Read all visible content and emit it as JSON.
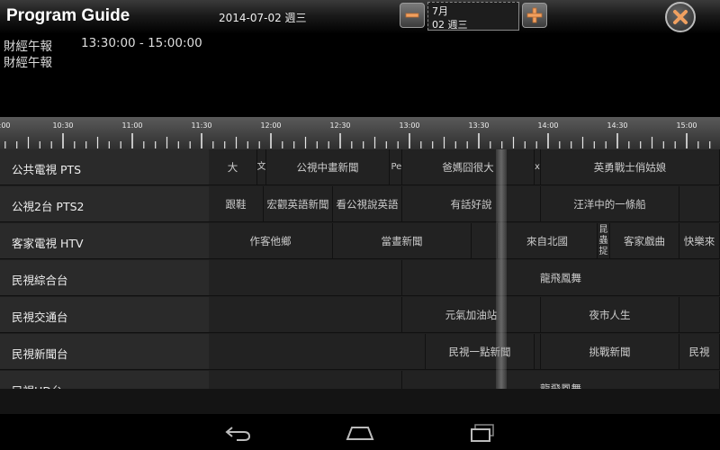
{
  "app": {
    "title": "Program Guide"
  },
  "header": {
    "date_label": "2014-07-02 週三",
    "date_picker": {
      "month": "7月",
      "day": "02  週三"
    }
  },
  "info": {
    "title_line1": "財經午報",
    "time_range": "13:30:00 - 15:00:00",
    "title_line2": "財經午報"
  },
  "timeline": {
    "labels": [
      "10:30",
      "11:00",
      "11:30",
      "12:00",
      "12:30",
      "13:00",
      "13:30",
      "14:00",
      "14:30",
      "15:00"
    ]
  },
  "channels": [
    {
      "name": "公共電視 PTS",
      "programs": [
        "大",
        "文",
        "公視中畫新聞",
        "Peo",
        "爸媽囧很大",
        "x",
        "英勇戰士俏姑娘"
      ]
    },
    {
      "name": "公視2台 PTS2",
      "programs": [
        "跟鞋",
        "宏觀英語新聞",
        "看公視說英語",
        "有話好說",
        "汪洋中的一條船",
        ""
      ]
    },
    {
      "name": "客家電視 HTV",
      "programs": [
        "作客他鄉",
        "當晝新聞",
        "",
        "來自北國",
        "昆蟲捉",
        "客家戲曲",
        "快樂來"
      ]
    },
    {
      "name": "民視綜合台",
      "programs": [
        "",
        "龍飛鳳舞"
      ]
    },
    {
      "name": "民視交通台",
      "programs": [
        "",
        "元氣加油站",
        "夜市人生",
        ""
      ]
    },
    {
      "name": "民視新聞台",
      "programs": [
        "",
        "民視一點新聞",
        "",
        "挑戰新聞",
        "民視"
      ]
    },
    {
      "name": "民視HD台",
      "programs": [
        "",
        "龍飛鳳舞"
      ]
    }
  ],
  "colors": {
    "accent_orange": "#f0a060",
    "topbar": "#1a1a1a",
    "grid_bg": "#222222"
  },
  "icons": {
    "minus": "minus-icon",
    "plus": "plus-icon",
    "close": "close-icon",
    "back": "back-icon",
    "home": "home-icon",
    "recent": "recent-apps-icon"
  }
}
